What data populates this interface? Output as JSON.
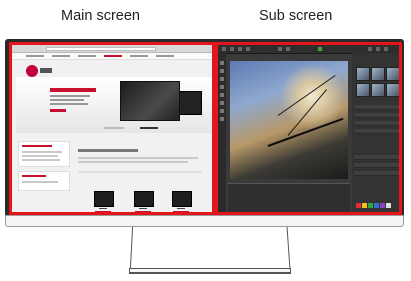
{
  "captions": {
    "main": "Main screen",
    "sub": "Sub screen"
  },
  "screens": {
    "main": {
      "content": "web-browser-page",
      "highlight_color": "#e4161c"
    },
    "sub": {
      "content": "photo-editor",
      "highlight_color": "#e4161c"
    }
  },
  "colors": {
    "brand": "#c4003a",
    "accent_orange": "#ff8a00",
    "bezel": "#2a2a2a"
  },
  "icons": {
    "logo": "lg-logo-icon"
  }
}
